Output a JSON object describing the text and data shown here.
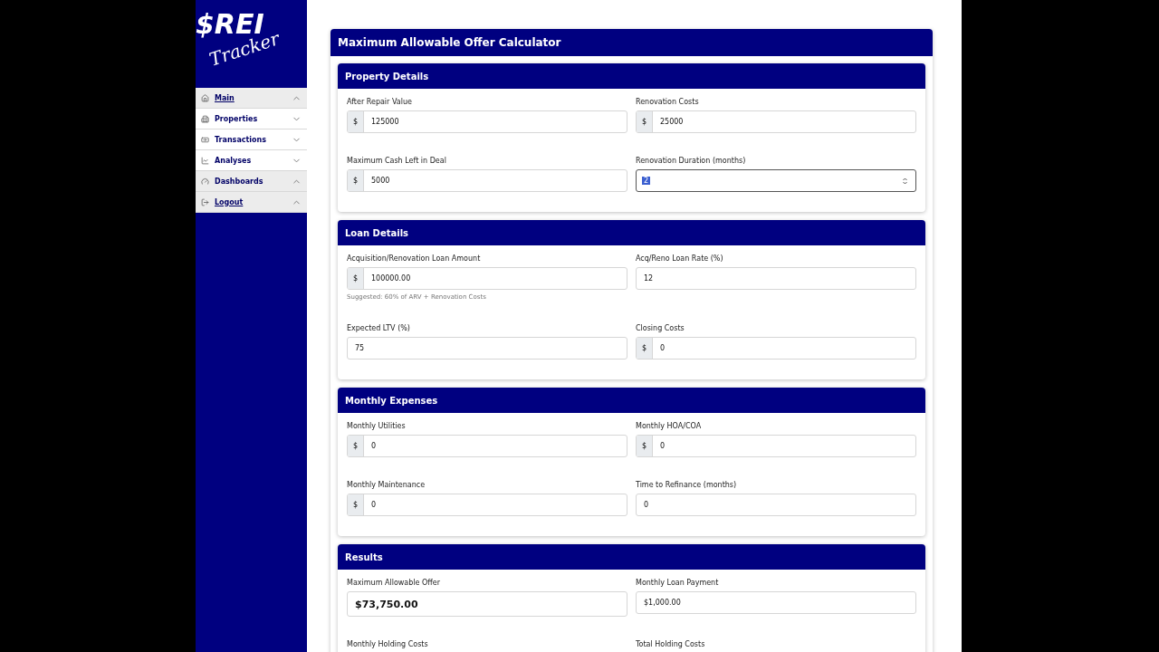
{
  "logo": {
    "mark": "$REI",
    "script": "Tracker"
  },
  "sidebar": {
    "items": [
      {
        "label": "Main",
        "kind": "link",
        "expanded": true
      },
      {
        "label": "Properties",
        "kind": "menu",
        "expanded": false
      },
      {
        "label": "Transactions",
        "kind": "menu",
        "expanded": false
      },
      {
        "label": "Analyses",
        "kind": "menu",
        "expanded": false
      },
      {
        "label": "Dashboards",
        "kind": "menu",
        "expanded": true
      },
      {
        "label": "Logout",
        "kind": "link",
        "expanded": true
      }
    ]
  },
  "calculator": {
    "title": "Maximum Allowable Offer Calculator",
    "sections": [
      {
        "title": "Property Details",
        "fields": [
          {
            "label": "After Repair Value",
            "prefix": "$",
            "value": "125000"
          },
          {
            "label": "Renovation Costs",
            "prefix": "$",
            "value": "25000"
          },
          {
            "label": "Maximum Cash Left in Deal",
            "prefix": "$",
            "value": "5000"
          },
          {
            "label": "Renovation Duration (months)",
            "value": "2",
            "kind": "spinner",
            "focused": true
          }
        ]
      },
      {
        "title": "Loan Details",
        "fields": [
          {
            "label": "Acquisition/Renovation Loan Amount",
            "prefix": "$",
            "value": "100000.00",
            "hint": "Suggested: 60% of ARV + Renovation Costs"
          },
          {
            "label": "Acq/Reno Loan Rate (%)",
            "value": "12"
          },
          {
            "label": "Expected LTV (%)",
            "value": "75"
          },
          {
            "label": "Closing Costs",
            "prefix": "$",
            "value": "0"
          }
        ]
      },
      {
        "title": "Monthly Expenses",
        "fields": [
          {
            "label": "Monthly Utilities",
            "prefix": "$",
            "value": "0"
          },
          {
            "label": "Monthly HOA/COA",
            "prefix": "$",
            "value": "0"
          },
          {
            "label": "Monthly Maintenance",
            "prefix": "$",
            "value": "0"
          },
          {
            "label": "Time to Refinance (months)",
            "value": "0"
          }
        ]
      },
      {
        "title": "Results",
        "fields": [
          {
            "label": "Maximum Allowable Offer",
            "value": "$73,750.00",
            "kind": "highlight"
          },
          {
            "label": "Monthly Loan Payment",
            "value": "$1,000.00"
          },
          {
            "label": "Monthly Holding Costs"
          },
          {
            "label": "Total Holding Costs"
          }
        ]
      }
    ]
  }
}
